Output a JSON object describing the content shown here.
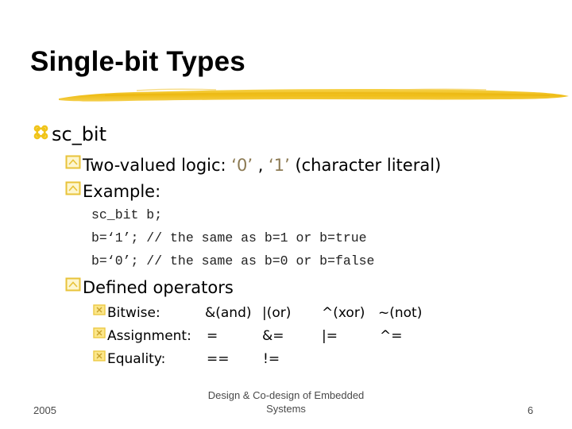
{
  "slide": {
    "title": "Single-bit Types",
    "accent_color": "#f1c01e",
    "bullet_color": "#e8c33a",
    "literal_color": "#8c7a53",
    "level1": {
      "icon": "command-icon",
      "text": "sc_bit"
    },
    "level2": [
      {
        "icon": "triangle-box-icon",
        "text_before": "Two-valued logic: ",
        "literal_0": "‘0’",
        "separator": " , ",
        "literal_1": "‘1’",
        "text_after": " (character literal)"
      },
      {
        "icon": "triangle-box-icon",
        "text": "Example:"
      },
      {
        "icon": "triangle-box-icon",
        "text": "Defined operators"
      }
    ],
    "code_lines": [
      "sc_bit b;",
      "b=‘1’; // the same as b=1 or b=true",
      "b=‘0’; // the same as b=0 or b=false"
    ],
    "operators": [
      {
        "icon": "x-box-icon",
        "label": "Bitwise:",
        "cols": [
          "&(and)",
          "|(or)",
          "^(xor)",
          "~(not)"
        ]
      },
      {
        "icon": "x-box-icon",
        "label": "Assignment:",
        "cols": [
          "=",
          "&=",
          "|=",
          "^="
        ]
      },
      {
        "icon": "x-box-icon",
        "label": "Equality:",
        "cols": [
          "==",
          "!=",
          "",
          ""
        ]
      }
    ]
  },
  "footer": {
    "year": "2005",
    "course_line1": "Design & Co-design of Embedded",
    "course_line2": "Systems",
    "page_number": "6"
  }
}
